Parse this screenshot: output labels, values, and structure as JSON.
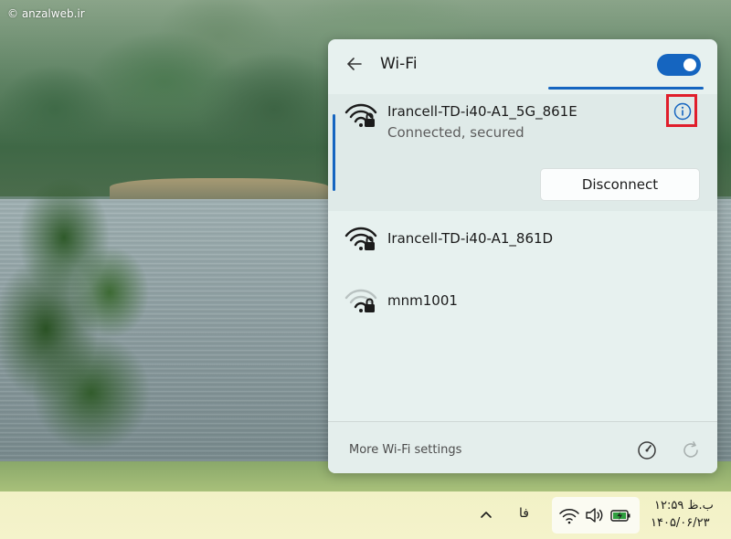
{
  "watermark": "© anzalweb.ir",
  "flyout": {
    "title": "Wi-Fi",
    "toggle_on": true,
    "accent_color": "#1565c0",
    "highlight_color": "#e01e2b",
    "connected_network": {
      "name": "Irancell-TD-i40-A1_5G_861E",
      "status": "Connected, secured",
      "disconnect_label": "Disconnect",
      "icon": "wifi-secured-icon",
      "info_icon": "info-icon"
    },
    "networks": [
      {
        "name": "Irancell-TD-i40-A1_861D",
        "icon": "wifi-secured-icon"
      },
      {
        "name": "mnm1001",
        "icon": "wifi-weak-secured-icon"
      }
    ],
    "footer": {
      "more_settings_label": "More Wi-Fi settings",
      "speed_icon": "gauge-icon",
      "refresh_icon": "refresh-icon"
    }
  },
  "taskbar": {
    "overflow_icon": "chevron-up-icon",
    "language": "فا",
    "tray_icons": [
      "wifi-icon",
      "volume-icon",
      "battery-charging-icon"
    ],
    "time": "۱۲:۵۹ ب.ظ",
    "date": "۱۴۰۵/۰۶/۲۳"
  }
}
